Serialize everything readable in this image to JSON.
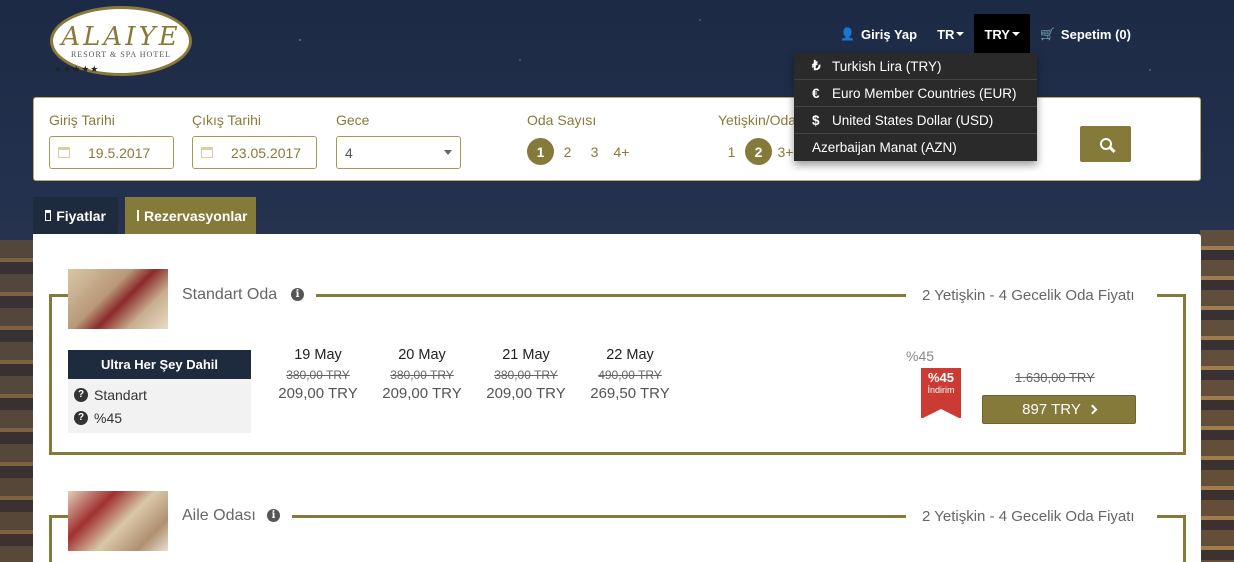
{
  "logo": {
    "word": "ALAIYE",
    "sub": "RESORT & SPA HOTEL",
    "stars": "★★★★★"
  },
  "topnav": {
    "login": "Giriş Yap",
    "language": "TR",
    "currency": "TRY",
    "cart": "Sepetim (0)"
  },
  "currency_menu": [
    {
      "symbol": "₺",
      "label": "Turkish Lira (TRY)"
    },
    {
      "symbol": "€",
      "label": "Euro Member Countries (EUR)"
    },
    {
      "symbol": "$",
      "label": "United States Dollar (USD)"
    },
    {
      "symbol": "",
      "label": "Azerbaijan Manat (AZN)"
    }
  ],
  "search": {
    "checkin_label": "Giriş Tarihi",
    "checkin_value": "19.5.2017",
    "checkout_label": "Çıkış Tarihi",
    "checkout_value": "23.05.2017",
    "nights_label": "Gece",
    "nights_value": "4",
    "rooms_label": "Oda Sayısı",
    "rooms_options": [
      "1",
      "2",
      "3",
      "4+"
    ],
    "rooms_selected": "1",
    "adults_label": "Yetişkin/Oda",
    "adults_options": [
      "1",
      "2",
      "3+"
    ],
    "adults_selected": "2"
  },
  "tabs": {
    "prices": "Fiyatlar",
    "reservations": "Rezervasyonlar"
  },
  "rooms": [
    {
      "name": "Standart Oda",
      "price_title": "2 Yetişkin - 4 Gecelik Oda Fiyatı",
      "board": {
        "title": "Ultra Her Şey Dahil",
        "row1": "Standart",
        "row2": "%45"
      },
      "days": [
        {
          "date": "19 May",
          "old": "380,00 TRY",
          "new": "209,00 TRY"
        },
        {
          "date": "20 May",
          "old": "380,00 TRY",
          "new": "209,00 TRY"
        },
        {
          "date": "21 May",
          "old": "380,00 TRY",
          "new": "209,00 TRY"
        },
        {
          "date": "22 May",
          "old": "490,00 TRY",
          "new": "269,50 TRY"
        }
      ],
      "discount_text": "%45",
      "ribbon_pct": "%45",
      "ribbon_label": "İndirim",
      "old_total": "1.630,00 TRY",
      "total": "897 TRY"
    },
    {
      "name": "Aile Odası",
      "price_title": "2 Yetişkin - 4 Gecelik Oda Fiyatı"
    }
  ],
  "colors": {
    "accent": "#857a3a",
    "dark": "#1e2a3e",
    "ribbon": "#cc3b33"
  }
}
